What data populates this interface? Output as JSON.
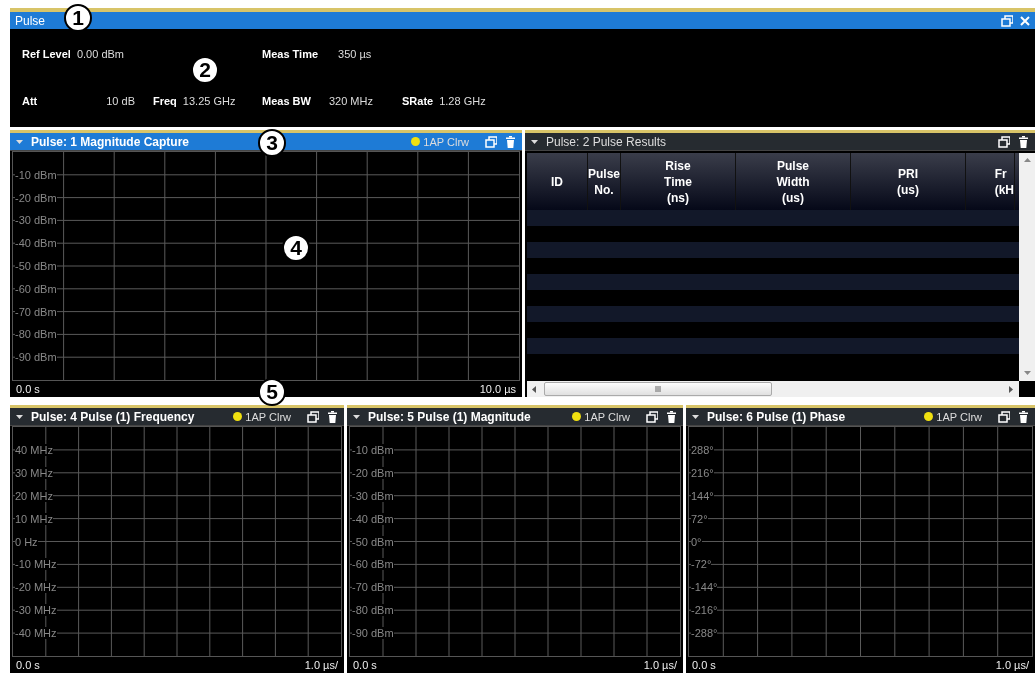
{
  "window": {
    "title": "Pulse"
  },
  "settings": [
    [
      {
        "label": "Ref Level",
        "value": "0.00 dBm"
      },
      {
        "label": "Meas Time",
        "value": "350 µs"
      }
    ],
    [
      {
        "label": "Att",
        "value": "10 dB"
      },
      {
        "label": "Freq",
        "value": "13.25 GHz"
      },
      {
        "label": "Meas BW",
        "value": "320 MHz"
      },
      {
        "label": "SRate",
        "value": "1.28 GHz"
      }
    ]
  ],
  "upper_row": [
    {
      "kind": "plot",
      "title": "Pulse: 1 Magnitude Capture",
      "selected": true,
      "trace": {
        "label": "1AP Clrw",
        "color": "#f0e010"
      },
      "y_labels": [
        "-10 dBm",
        "-20 dBm",
        "-30 dBm",
        "-40 dBm",
        "-50 dBm",
        "-60 dBm",
        "-70 dBm",
        "-80 dBm",
        "-90 dBm"
      ],
      "x_start": "0.0 s",
      "x_end": "10.0 µs"
    },
    {
      "kind": "table",
      "title": "Pulse: 2 Pulse Results",
      "selected": false,
      "columns": [
        "ID",
        "Pulse\nNo.",
        "Rise\nTime\n(ns)",
        "Pulse\nWidth\n(us)",
        "PRI\n(us)",
        "Fr\n(kH"
      ]
    }
  ],
  "lower_row": [
    {
      "kind": "plot",
      "title": "Pulse: 4 Pulse (1) Frequency",
      "selected": false,
      "trace": {
        "label": "1AP Clrw",
        "color": "#f0e010"
      },
      "y_labels": [
        "40 MHz",
        "30 MHz",
        "20 MHz",
        "10 MHz",
        "0 Hz",
        "-10 MHz",
        "-20 MHz",
        "-30 MHz",
        "-40 MHz"
      ],
      "x_start": "0.0 s",
      "x_end": "1.0 µs/"
    },
    {
      "kind": "plot",
      "title": "Pulse: 5 Pulse (1) Magnitude",
      "selected": false,
      "trace": {
        "label": "1AP Clrw",
        "color": "#f0e010"
      },
      "y_labels": [
        "-10 dBm",
        "-20 dBm",
        "-30 dBm",
        "-40 dBm",
        "-50 dBm",
        "-60 dBm",
        "-70 dBm",
        "-80 dBm",
        "-90 dBm"
      ],
      "x_start": "0.0 s",
      "x_end": "1.0 µs/"
    },
    {
      "kind": "plot",
      "title": "Pulse: 6 Pulse (1) Phase",
      "selected": false,
      "trace": {
        "label": "1AP Clrw",
        "color": "#f0e010"
      },
      "y_labels": [
        "288°",
        "216°",
        "144°",
        "72°",
        "0°",
        "-72°",
        "-144°",
        "-216°",
        "-288°"
      ],
      "x_start": "0.0 s",
      "x_end": "1.0 µs/"
    }
  ],
  "callouts": [
    "1",
    "2",
    "3",
    "4",
    "5"
  ]
}
